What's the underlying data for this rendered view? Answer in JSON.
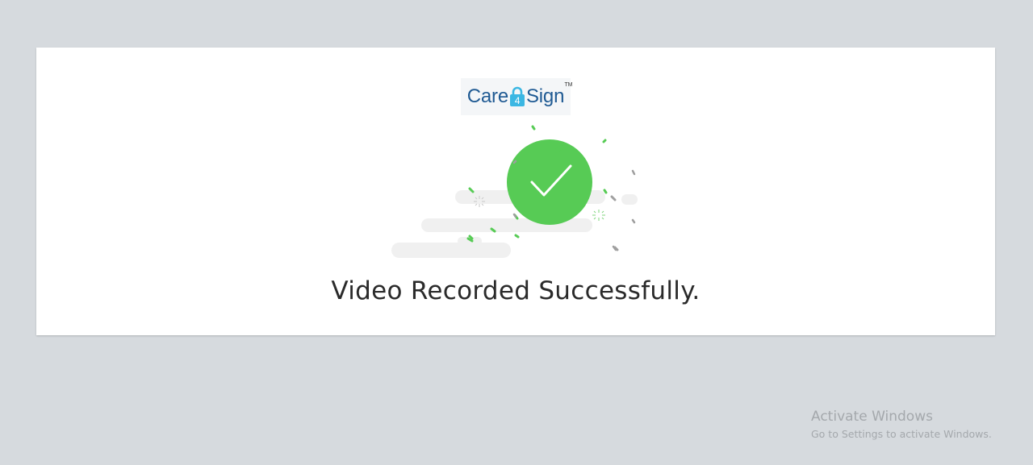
{
  "logo": {
    "text_left": "Care",
    "text_lock": "4",
    "text_right": "Sign",
    "trademark": "TM"
  },
  "message": {
    "title": "Video Recorded Successfully."
  },
  "watermark": {
    "title": "Activate Windows",
    "subtitle": "Go to Settings to activate Windows."
  },
  "colors": {
    "background": "#d6dade",
    "card": "#ffffff",
    "success_green": "#57cb55",
    "logo_blue": "#1f5a93",
    "lock_cyan": "#3bb7e3"
  },
  "icons": {
    "success": "checkmark-circle-icon",
    "logo_lock": "padlock-icon"
  }
}
